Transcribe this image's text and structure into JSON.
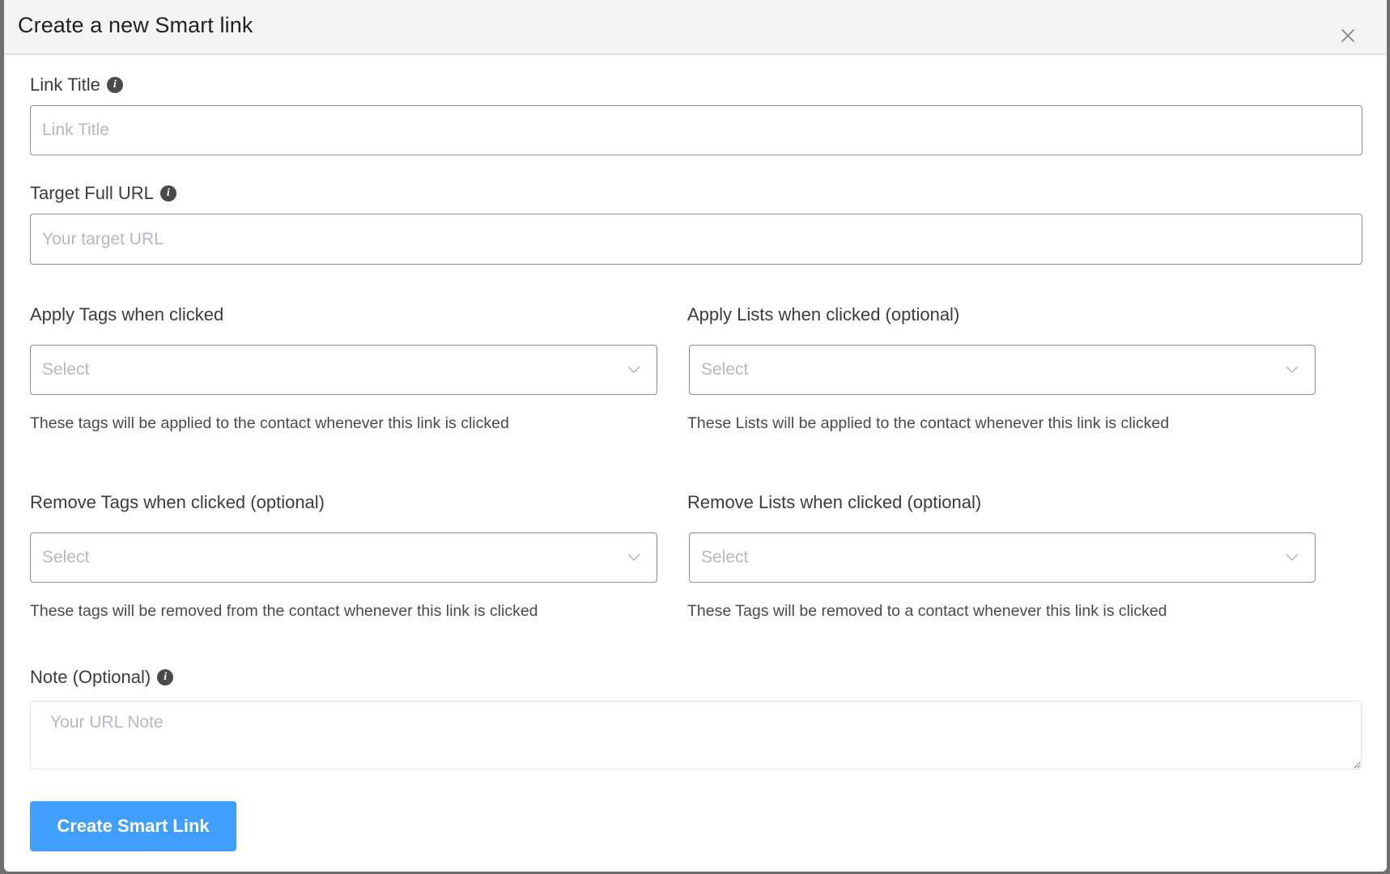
{
  "modal": {
    "title": "Create a new Smart link",
    "close_icon": "close-icon"
  },
  "fields": {
    "link_title": {
      "label": "Link Title",
      "info_icon": "info-icon",
      "placeholder": "Link Title",
      "value": ""
    },
    "target_url": {
      "label": "Target Full URL",
      "info_icon": "info-icon",
      "placeholder": "Your target URL",
      "value": ""
    },
    "apply_tags": {
      "label": "Apply Tags when clicked",
      "placeholder": "Select",
      "help": "These tags will be applied to the contact whenever this link is clicked"
    },
    "apply_lists": {
      "label": "Apply Lists when clicked (optional)",
      "placeholder": "Select",
      "help": "These Lists will be applied to the contact whenever this link is clicked"
    },
    "remove_tags": {
      "label": "Remove Tags when clicked (optional)",
      "placeholder": "Select",
      "help": "These tags will be removed from the contact whenever this link is clicked"
    },
    "remove_lists": {
      "label": "Remove Lists when clicked (optional)",
      "placeholder": "Select",
      "help": "These Tags will be removed to a contact whenever this link is clicked"
    },
    "note": {
      "label": "Note (Optional)",
      "info_icon": "info-icon",
      "placeholder": "Your URL Note",
      "value": ""
    }
  },
  "actions": {
    "submit_label": "Create Smart Link"
  },
  "colors": {
    "primary": "#409eff",
    "header_bg": "#f3f3f3",
    "overlay": "#6f6f6f"
  }
}
